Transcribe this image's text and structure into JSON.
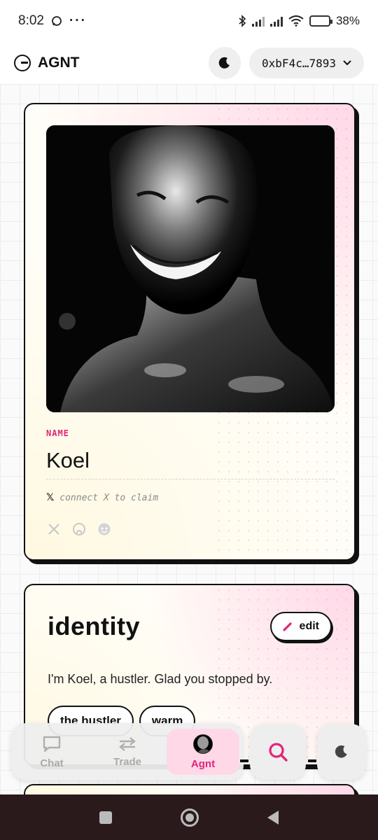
{
  "status_bar": {
    "time": "8:02",
    "battery": "38%",
    "battery_level": 0.38
  },
  "header": {
    "brand": "AGNT",
    "wallet": "0xbF4c…7893"
  },
  "profile": {
    "name_label": "NAME",
    "name": "Koel",
    "claim_text": "connect X to claim"
  },
  "identity": {
    "title": "identity",
    "edit_label": "edit",
    "bio": "I'm Koel, a hustler. Glad you stopped by.",
    "tags": [
      "the hustler",
      "warm"
    ]
  },
  "nav": {
    "chat": "Chat",
    "trade": "Trade",
    "agnt": "Agnt"
  },
  "colors": {
    "accent": "#e0267a",
    "active_tab_bg": "#ffd8e8"
  }
}
